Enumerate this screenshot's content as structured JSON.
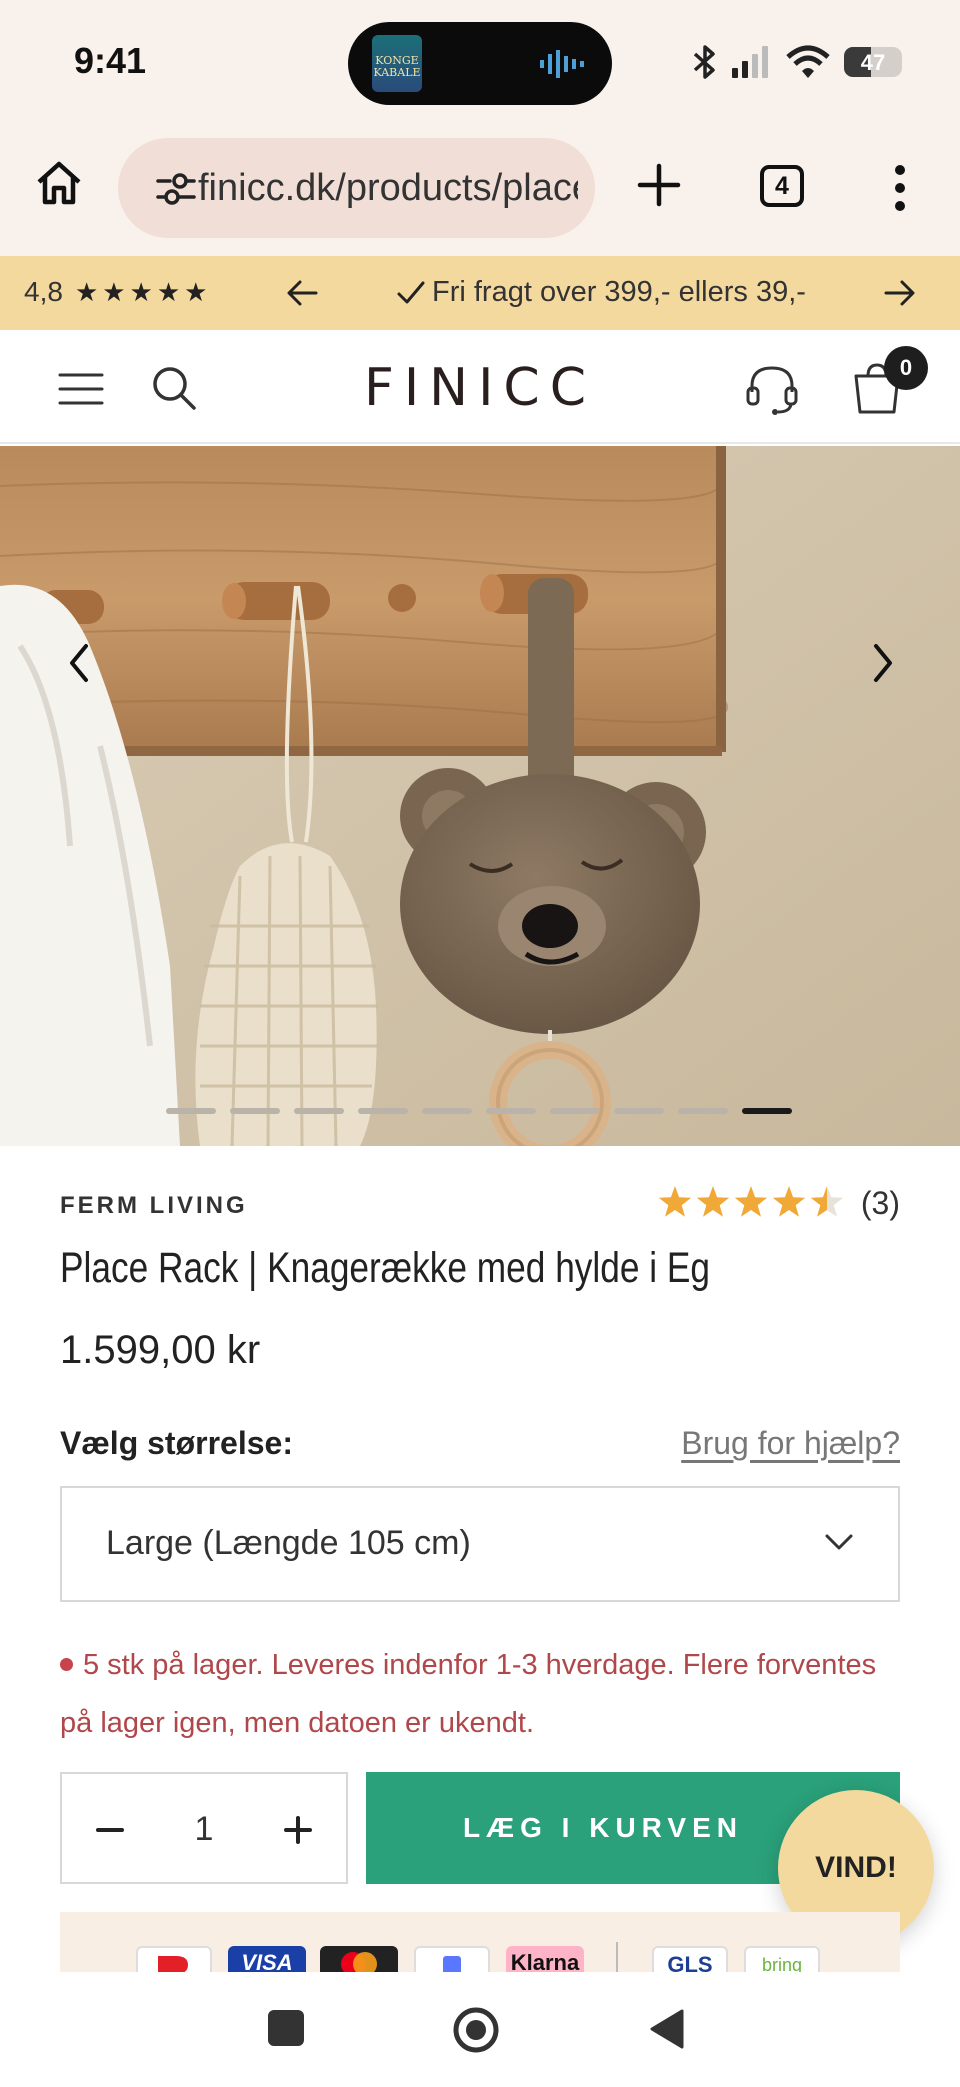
{
  "status_bar": {
    "time": "9:41",
    "island_app_label": "KONGE KABALE",
    "battery": "47",
    "battery_level": 0.47,
    "icons": [
      "bluetooth-icon",
      "signal-icon",
      "wifi-icon",
      "battery-icon"
    ]
  },
  "browser": {
    "url": "finicc.dk/products/place-rack",
    "tab_count": "4",
    "icons": [
      "home-icon",
      "site-settings-icon",
      "new-tab-icon",
      "tabs-icon",
      "more-icon"
    ]
  },
  "announcement": {
    "rating": "4,8",
    "stars": "★★★★★",
    "message": "Fri fragt over 399,- ellers 39,-",
    "icons": [
      "arrow-left-icon",
      "check-icon",
      "arrow-right-icon"
    ]
  },
  "header": {
    "logo": "FINICC",
    "cart_count": "0",
    "icons": [
      "menu-icon",
      "search-icon",
      "support-headset-icon",
      "cart-icon"
    ]
  },
  "gallery": {
    "image_count": 10,
    "active_index": 9,
    "icons": [
      "chevron-left-icon",
      "chevron-right-icon"
    ]
  },
  "product": {
    "brand": "FERM LIVING",
    "rating": 4.5,
    "review_count": "(3)",
    "title": "Place Rack | Knagerække med hylde i Eg",
    "price": "1.599,00 kr",
    "size_label": "Vælg størrelse:",
    "help_link": "Brug for hjælp?",
    "size_selected": "Large (Længde 105 cm)",
    "stock_message": "5 stk på lager. Leveres indenfor 1-3 hverdage. Flere forventes på lager igen, men datoen er ukendt.",
    "quantity": "1",
    "add_to_cart": "LÆG I KURVEN",
    "promo_button": "VIND!"
  },
  "payments": {
    "methods": [
      "VISA",
      "Klarna",
      "GLS",
      "bring"
    ]
  },
  "colors": {
    "announcement_bg": "#f4d99e",
    "add_to_cart_bg": "#2aa17a",
    "stock_text": "#b0474a",
    "star": "#f0a837"
  }
}
